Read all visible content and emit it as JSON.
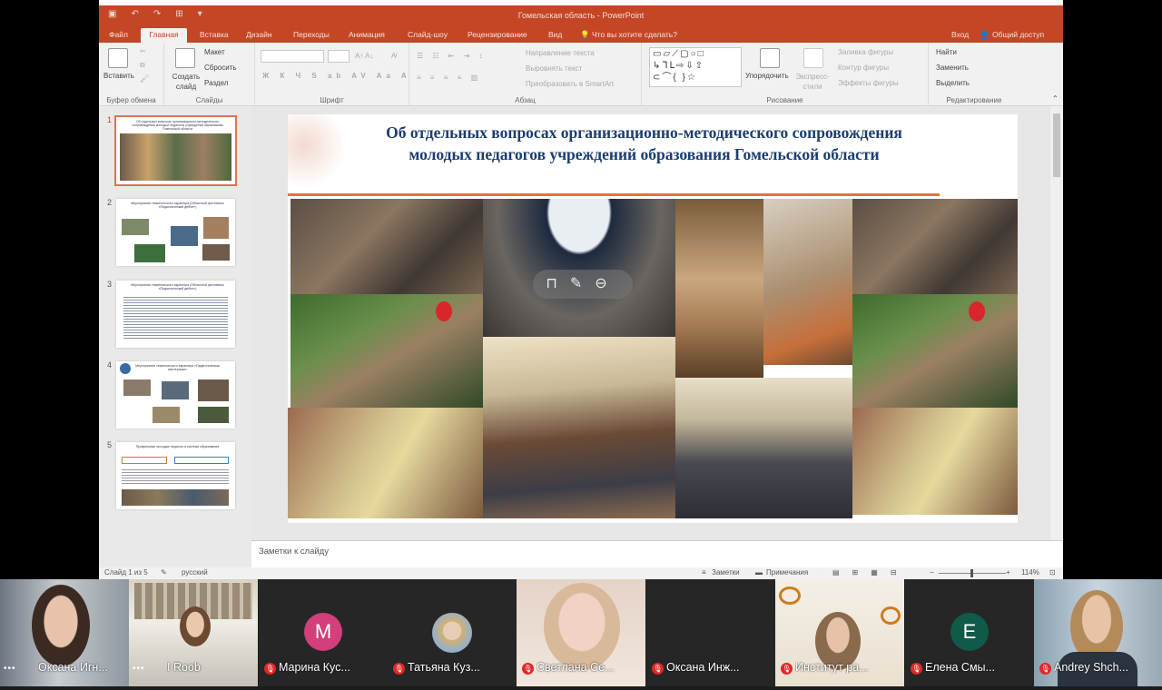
{
  "window": {
    "title": "Гомельская область - PowerPoint"
  },
  "ribbon_tabs": [
    "Файл",
    "Главная",
    "Вставка",
    "Дизайн",
    "Переходы",
    "Анимация",
    "Слайд-шоу",
    "Рецензирование",
    "Вид"
  ],
  "tell_me": "Что вы хотите сделать?",
  "sign_in": "Вход",
  "share": "Общий доступ",
  "ribbon": {
    "paste": "Вставить",
    "new_slide": "Создать слайд",
    "layout": "Макет",
    "reset": "Сбросить",
    "section": "Раздел",
    "text_direction": "Направление текста",
    "align_text": "Выровнять текст",
    "smartart": "Преобразовать в SmartArt",
    "arrange": "Упорядочить",
    "quick_styles": "Экспресс-стили",
    "shape_fill": "Заливка фигуры",
    "shape_outline": "Контур фигуры",
    "shape_effects": "Эффекты фигуры",
    "find": "Найти",
    "replace": "Заменить",
    "select": "Выделить",
    "groups": {
      "clipboard": "Буфер обмена",
      "slides": "Слайды",
      "font": "Шрифт",
      "paragraph": "Абзац",
      "drawing": "Рисование",
      "editing": "Редактирование"
    }
  },
  "thumbnails": [
    {
      "num": "1",
      "title": "Об отдельных вопросах организационно-методического сопровождения молодых педагогов учреждений образования Гомельской области"
    },
    {
      "num": "2",
      "title": "Мероприятия тематического характера (Областной фестиваль «Педагогический дебют»)"
    },
    {
      "num": "3",
      "title": "Мероприятия тематического характера (Областной фестиваль «Педагогический дебют»)"
    },
    {
      "num": "4",
      "title": "Мероприятия тематического характера «Педагогическая мастерская»"
    },
    {
      "num": "5",
      "title": "Профильные молодые педагоги в системе образования"
    }
  ],
  "slide": {
    "title": "Об отдельных вопросах организационно-методического сопровождения молодых педагогов учреждений образования Гомельской области"
  },
  "notes_placeholder": "Заметки к слайду",
  "status": {
    "slide_info": "Слайд 1 из 5",
    "language": "русский",
    "notes_btn": "Заметки",
    "comments_btn": "Примечания",
    "zoom": "114%"
  },
  "participants": [
    {
      "name": "Оксана Игн...",
      "muted": false,
      "type": "video"
    },
    {
      "name": "I Roob",
      "muted": false,
      "type": "video"
    },
    {
      "name": "Марина Кус...",
      "muted": true,
      "type": "avatar",
      "letter": "M",
      "color": "#d23f7b"
    },
    {
      "name": "Татьяна Куз...",
      "muted": true,
      "type": "photo"
    },
    {
      "name": "Светлана Се...",
      "muted": true,
      "type": "video"
    },
    {
      "name": "Оксана Инж...",
      "muted": true,
      "type": "blank"
    },
    {
      "name": "Институт ра...",
      "muted": true,
      "type": "video"
    },
    {
      "name": "Елена Смы...",
      "muted": true,
      "type": "avatar",
      "letter": "E",
      "color": "#0f5a48"
    },
    {
      "name": "Andrey Shch...",
      "muted": true,
      "type": "video"
    }
  ],
  "colors": {
    "ppt_accent": "#c44625",
    "slide_title": "#1b3d6e",
    "muted_red": "#e02828"
  }
}
